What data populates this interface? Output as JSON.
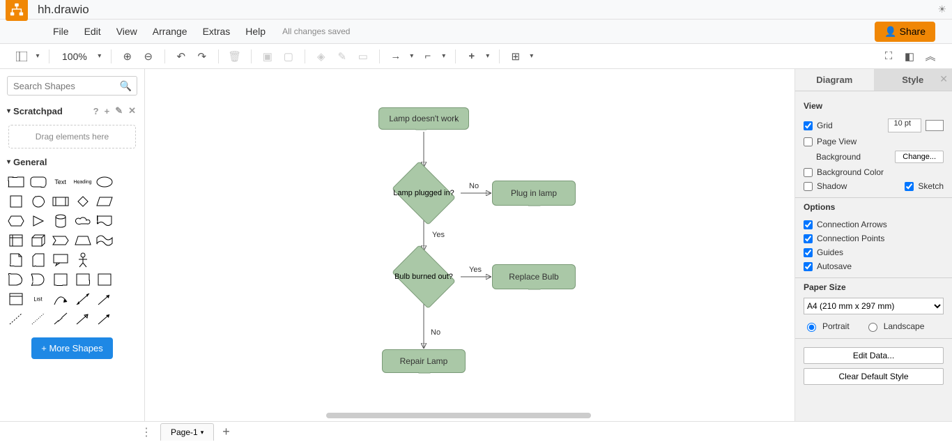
{
  "app": {
    "filename": "hh.drawio",
    "status": "All changes saved",
    "share_label": "Share"
  },
  "menu": {
    "file": "File",
    "edit": "Edit",
    "view": "View",
    "arrange": "Arrange",
    "extras": "Extras",
    "help": "Help"
  },
  "toolbar": {
    "zoom": "100%"
  },
  "left": {
    "search_placeholder": "Search Shapes",
    "scratchpad_label": "Scratchpad",
    "drag_hint": "Drag elements here",
    "general_label": "General",
    "more_shapes": "+ More Shapes"
  },
  "right": {
    "tab_diagram": "Diagram",
    "tab_style": "Style",
    "view_header": "View",
    "grid_label": "Grid",
    "grid_size": "10 pt",
    "pageview_label": "Page View",
    "background_label": "Background",
    "change_label": "Change...",
    "background_color_label": "Background Color",
    "shadow_label": "Shadow",
    "sketch_label": "Sketch",
    "options_header": "Options",
    "conn_arrows": "Connection Arrows",
    "conn_points": "Connection Points",
    "guides": "Guides",
    "autosave": "Autosave",
    "paper_header": "Paper Size",
    "paper_value": "A4 (210 mm x 297 mm)",
    "portrait": "Portrait",
    "landscape": "Landscape",
    "edit_data": "Edit Data...",
    "clear_style": "Clear Default Style"
  },
  "bottom": {
    "page1": "Page-1"
  },
  "chart_data": {
    "type": "flowchart",
    "nodes": [
      {
        "id": "n1",
        "shape": "rect",
        "label": "Lamp doesn't work"
      },
      {
        "id": "n2",
        "shape": "decision",
        "label": "Lamp plugged in?"
      },
      {
        "id": "n3",
        "shape": "rect",
        "label": "Plug in lamp"
      },
      {
        "id": "n4",
        "shape": "decision",
        "label": "Bulb burned out?"
      },
      {
        "id": "n5",
        "shape": "rect",
        "label": "Replace Bulb"
      },
      {
        "id": "n6",
        "shape": "rect",
        "label": "Repair Lamp"
      }
    ],
    "edges": [
      {
        "from": "n1",
        "to": "n2",
        "label": ""
      },
      {
        "from": "n2",
        "to": "n3",
        "label": "No"
      },
      {
        "from": "n2",
        "to": "n4",
        "label": "Yes"
      },
      {
        "from": "n4",
        "to": "n5",
        "label": "Yes"
      },
      {
        "from": "n4",
        "to": "n6",
        "label": "No"
      }
    ]
  }
}
